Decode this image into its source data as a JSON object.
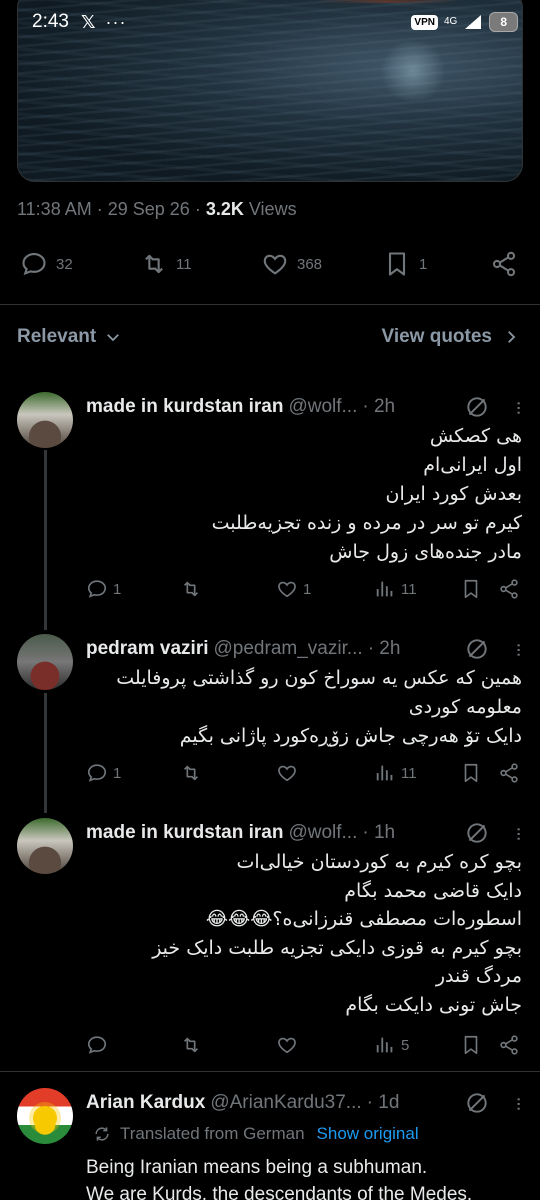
{
  "status_bar": {
    "time": "2:43",
    "x_icon": "𝕏",
    "dots": "···",
    "vpn": "VPN",
    "network": "4G",
    "battery": "8"
  },
  "tweet": {
    "time": "11:38 AM",
    "date": "29 Sep 26",
    "views_count": "3.2K",
    "views_label": "Views",
    "actions": {
      "replies": "32",
      "reposts": "11",
      "likes": "368",
      "bookmarks": "1"
    }
  },
  "sort": {
    "label": "Relevant",
    "view_quotes": "View quotes"
  },
  "replies": [
    {
      "name": "made in kurdstan iran",
      "handle": "@wolf...",
      "time": "· 2h",
      "lines": [
        "هی کصکش",
        "اول ایرانی‌ام",
        "بعدش کورد ایران",
        "کیرم تو سر در مرده و زنده تجزیه‌طلبت",
        "مادر جنده‌های زول جاش"
      ],
      "replies": "1",
      "reposts": "",
      "likes": "1",
      "views": "11"
    },
    {
      "name": "pedram vaziri",
      "handle": "@pedram_vazir...",
      "time": "· 2h",
      "lines": [
        "همین که عکس یه سوراخ کون رو گذاشتی پروفایلت",
        "معلومه کوردی",
        "دایک تۆ هەرچی جاش زۆڕەکورد پاژانی بگیم"
      ],
      "replies": "1",
      "reposts": "",
      "likes": "",
      "views": "11"
    },
    {
      "name": "made in kurdstan iran",
      "handle": "@wolf...",
      "time": "· 1h",
      "lines": [
        "بچو کره کیرم به کوردستان خیالی‌ات",
        "دایک قاضی محمد بگام",
        "اسطوره‌ات مصطفی قنرزانی‌ه؟😂😂😂",
        "بچو کیرم به قوزی دایکی تجزیه طلبت دایک خیز",
        "مردگ قندر",
        "جاش تونی دایکت بگام"
      ],
      "replies": "",
      "reposts": "",
      "likes": "",
      "views": "5"
    },
    {
      "name": "Arian Kardux",
      "handle": "@ArianKardu37...",
      "time": "· 1d",
      "translated_label": "Translated from German",
      "show_original": "Show original",
      "lines": [
        "Being Iranian means being a subhuman.",
        "We are Kurds, the descendants of the Medes."
      ]
    }
  ],
  "colors": {
    "background": "#000000",
    "text": "#e7e9ea",
    "muted": "#71767b",
    "link": "#1d9bf0",
    "divider": "#2f3336"
  },
  "icons": [
    "reply-icon",
    "repost-icon",
    "like-icon",
    "bookmark-icon",
    "share-icon",
    "views-icon",
    "grok-icon",
    "more-icon",
    "chevron-down-icon",
    "chevron-right-icon",
    "translate-icon"
  ]
}
